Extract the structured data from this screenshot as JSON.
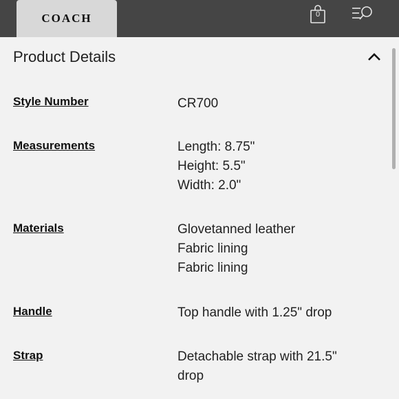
{
  "header": {
    "brand": "COACH",
    "cart_count": "0",
    "cart_icon": "shopping-bag-icon",
    "menu_icon": "menu-search-icon"
  },
  "panel": {
    "title": "Product Details",
    "toggle_icon": "chevron-up-icon"
  },
  "specs": [
    {
      "label": "Style Number",
      "values": [
        "CR700"
      ]
    },
    {
      "label": "Measurements",
      "values": [
        "Length: 8.75\"",
        "Height: 5.5\"",
        "Width: 2.0\""
      ]
    },
    {
      "label": "Materials",
      "values": [
        "Glovetanned leather",
        "Fabric lining",
        "Fabric lining"
      ]
    },
    {
      "label": "Handle",
      "values": [
        "Top handle with 1.25\" drop"
      ]
    },
    {
      "label": "Strap",
      "values": [
        "Detachable strap with 21.5\"",
        "drop"
      ]
    }
  ]
}
